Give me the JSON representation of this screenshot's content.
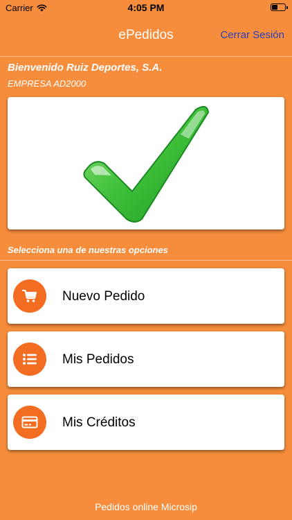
{
  "status_bar": {
    "carrier": "Carrier",
    "time": "4:05 PM",
    "wifi_icon": "wifi-icon",
    "battery_icon": "battery-icon"
  },
  "header": {
    "title": "ePedidos",
    "logout_label": "Cerrar Sesión",
    "logout_color": "#2b3fb8"
  },
  "welcome": {
    "greeting": "Bienvenido Ruiz Deportes, S.A.",
    "company": "EMPRESA AD2000"
  },
  "hero": {
    "icon": "checkmark-icon",
    "check_color": "#3fbf3a"
  },
  "options": {
    "label": "Selecciona una de nuestras opciones",
    "items": [
      {
        "label": "Nuevo Pedido",
        "icon": "cart-icon"
      },
      {
        "label": "Mis Pedidos",
        "icon": "list-icon"
      },
      {
        "label": "Mis Créditos",
        "icon": "credit-card-icon"
      }
    ]
  },
  "footer": {
    "text": "Pedidos online Microsip"
  },
  "colors": {
    "background": "#f68d3c",
    "accent": "#f26d21",
    "card": "#ffffff"
  }
}
